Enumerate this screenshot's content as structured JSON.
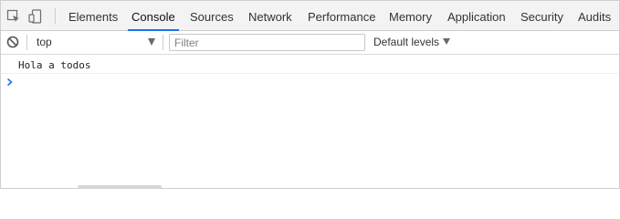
{
  "tabs": [
    {
      "label": "Elements"
    },
    {
      "label": "Console",
      "active": true
    },
    {
      "label": "Sources"
    },
    {
      "label": "Network"
    },
    {
      "label": "Performance"
    },
    {
      "label": "Memory"
    },
    {
      "label": "Application"
    },
    {
      "label": "Security"
    },
    {
      "label": "Audits"
    }
  ],
  "toolbar": {
    "context": "top",
    "filter_placeholder": "Filter",
    "levels_label": "Default levels"
  },
  "console": {
    "messages": [
      "Hola a todos"
    ]
  },
  "icons": {
    "inspect": "inspect-element-icon",
    "device": "device-toolbar-icon",
    "clear": "clear-console-icon",
    "prompt": "console-prompt-chevron-icon"
  },
  "colors": {
    "accent": "#1a73e8",
    "tabbar_bg": "#f3f3f3",
    "prompt": "#1a73e8"
  }
}
